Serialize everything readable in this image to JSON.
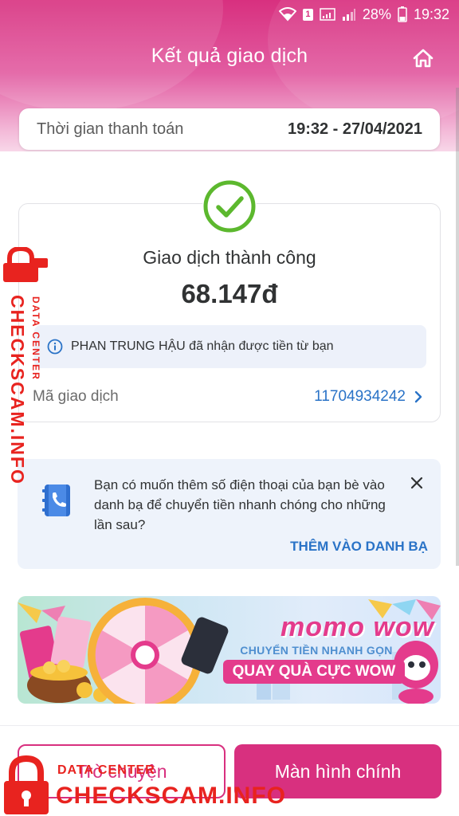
{
  "status_bar": {
    "sim_label": "1",
    "battery": "28%",
    "time": "19:32"
  },
  "header": {
    "title": "Kết quả giao dịch",
    "home_icon": "home-icon"
  },
  "payment_time": {
    "label": "Thời gian thanh toán",
    "value": "19:32 - 27/04/2021"
  },
  "result": {
    "status": "Giao dịch thành công",
    "amount": "68.147đ",
    "info_message": "PHAN TRUNG HẬU đã nhận được tiền từ bạn",
    "transaction_label": "Mã giao dịch",
    "transaction_id": "11704934242"
  },
  "contact_suggestion": {
    "message": "Bạn có muốn thêm số điện thoại của bạn bè vào danh bạ để chuyển tiền nhanh chóng cho những lần sau?",
    "action": "THÊM VÀO DANH BẠ"
  },
  "banner": {
    "brand": "momo wow",
    "line1": "CHUYỂN TIỀN NHANH GỌN",
    "line2": "QUAY QUÀ CỰC WOW"
  },
  "buttons": {
    "chat": "Trò chuyện",
    "main_screen": "Màn hình chính"
  },
  "watermark": {
    "side_big": "CHECKSCAM.INFO",
    "side_small": "DATA CENTER",
    "bottom_small": "DATA CENTER",
    "bottom_big": "CHECKSCAM.INFO"
  },
  "colors": {
    "brand_pink": "#d8307f",
    "link_blue": "#2a73c7",
    "success_green": "#5cb82e",
    "watermark_red": "#e8231f"
  }
}
